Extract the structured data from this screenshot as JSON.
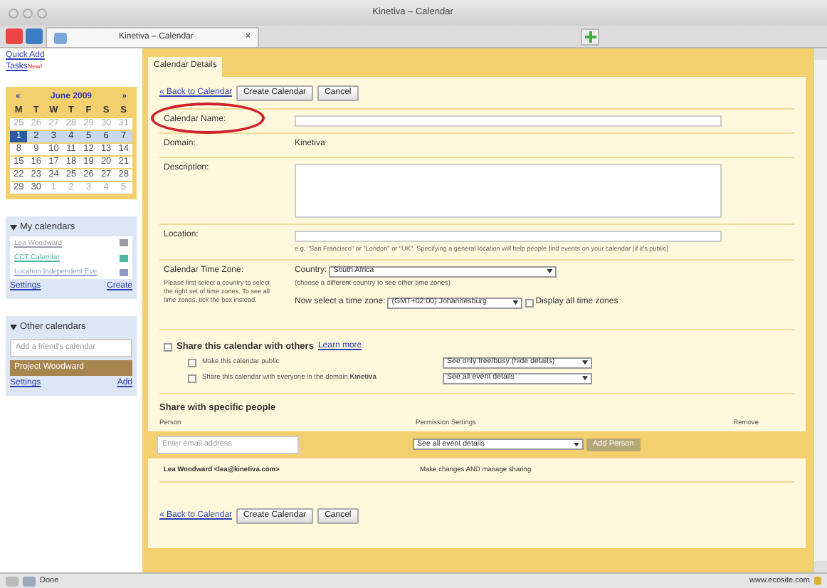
{
  "window": {
    "title": "Kinetiva – Calendar",
    "tab_title": "Kinetiva – Calendar",
    "tab_close": "×"
  },
  "sidebar": {
    "quick_add": "Quick Add",
    "tasks": "Tasks",
    "tasks_badge": "New!",
    "mini_calendar": {
      "prev": "«",
      "month": "June 2009",
      "next": "»",
      "weekdays": [
        "M",
        "T",
        "W",
        "T",
        "F",
        "S",
        "S"
      ],
      "weeks": [
        {
          "selected": false,
          "days": [
            {
              "day": "25",
              "other_month": true,
              "today": false
            },
            {
              "day": "26",
              "other_month": true,
              "today": false
            },
            {
              "day": "27",
              "other_month": true,
              "today": false
            },
            {
              "day": "28",
              "other_month": true,
              "today": false
            },
            {
              "day": "29",
              "other_month": true,
              "today": false
            },
            {
              "day": "30",
              "other_month": true,
              "today": false
            },
            {
              "day": "31",
              "other_month": true,
              "today": false
            }
          ]
        },
        {
          "selected": true,
          "days": [
            {
              "day": "1",
              "other_month": false,
              "today": true
            },
            {
              "day": "2",
              "other_month": false,
              "today": false
            },
            {
              "day": "3",
              "other_month": false,
              "today": false
            },
            {
              "day": "4",
              "other_month": false,
              "today": false
            },
            {
              "day": "5",
              "other_month": false,
              "today": false
            },
            {
              "day": "6",
              "other_month": false,
              "today": false
            },
            {
              "day": "7",
              "other_month": false,
              "today": false
            }
          ]
        },
        {
          "selected": false,
          "days": [
            {
              "day": "8",
              "other_month": false,
              "today": false
            },
            {
              "day": "9",
              "other_month": false,
              "today": false
            },
            {
              "day": "10",
              "other_month": false,
              "today": false
            },
            {
              "day": "11",
              "other_month": false,
              "today": false
            },
            {
              "day": "12",
              "other_month": false,
              "today": false
            },
            {
              "day": "13",
              "other_month": false,
              "today": false
            },
            {
              "day": "14",
              "other_month": false,
              "today": false
            }
          ]
        },
        {
          "selected": false,
          "days": [
            {
              "day": "15",
              "other_month": false,
              "today": false
            },
            {
              "day": "16",
              "other_month": false,
              "today": false
            },
            {
              "day": "17",
              "other_month": false,
              "today": false
            },
            {
              "day": "18",
              "other_month": false,
              "today": false
            },
            {
              "day": "19",
              "other_month": false,
              "today": false
            },
            {
              "day": "20",
              "other_month": false,
              "today": false
            },
            {
              "day": "21",
              "other_month": false,
              "today": false
            }
          ]
        },
        {
          "selected": false,
          "days": [
            {
              "day": "22",
              "other_month": false,
              "today": false
            },
            {
              "day": "23",
              "other_month": false,
              "today": false
            },
            {
              "day": "24",
              "other_month": false,
              "today": false
            },
            {
              "day": "25",
              "other_month": false,
              "today": false
            },
            {
              "day": "26",
              "other_month": false,
              "today": false
            },
            {
              "day": "27",
              "other_month": false,
              "today": false
            },
            {
              "day": "28",
              "other_month": false,
              "today": false
            }
          ]
        },
        {
          "selected": false,
          "days": [
            {
              "day": "29",
              "other_month": false,
              "today": false
            },
            {
              "day": "30",
              "other_month": false,
              "today": false
            },
            {
              "day": "1",
              "other_month": true,
              "today": false
            },
            {
              "day": "2",
              "other_month": true,
              "today": false
            },
            {
              "day": "3",
              "other_month": true,
              "today": false
            },
            {
              "day": "4",
              "other_month": true,
              "today": false
            },
            {
              "day": "5",
              "other_month": true,
              "today": false
            }
          ]
        }
      ]
    },
    "my_calendars": {
      "title": "My calendars",
      "items": [
        {
          "name": "Lea Woodward",
          "color": "#9a9aa6"
        },
        {
          "name": "CCT Calendar",
          "color": "#4cb6a0"
        },
        {
          "name": "Location Independent Eve",
          "color": "#8a9cc4"
        }
      ],
      "settings": "Settings",
      "create": "Create"
    },
    "other_calendars": {
      "title": "Other calendars",
      "placeholder": "Add a friend's calendar",
      "items": [
        {
          "name": "Project Woodward",
          "color": "#a8844e"
        }
      ],
      "settings": "Settings",
      "add": "Add"
    }
  },
  "main": {
    "tab": "Calendar Details",
    "back": "« Back to Calendar",
    "create": "Create Calendar",
    "cancel": "Cancel",
    "name_label": "Calendar Name:",
    "domain_label": "Domain:",
    "domain": "Kinetiva",
    "description_label": "Description:",
    "location_label": "Location:",
    "location_hint": "e.g. \"San Francisco\" or \"London\" or \"UK\". Specifying a general location will help people find events on your calendar (if it's public)",
    "timezone_label": "Calendar Time Zone:",
    "timezone_help": "Please first select a country to select the right set of time zones. To see all time zones, tick the box instead.",
    "country_label": "Country:",
    "country": "South Africa",
    "country_hint": "(choose a different country to see other time zones)",
    "tz_label": "Now select a time zone:",
    "tz": "(GMT+02:00) Johannesburg",
    "display_all": "Display all time zones",
    "display_all_checked": false,
    "share_checked": false,
    "share_title": "Share this calendar with others",
    "learn_more": "Learn more",
    "share_options": [
      {
        "label": "Make this calendar public",
        "checked": false,
        "select": "See only free/busy (hide details)"
      },
      {
        "label": "Share this calendar with everyone in the domain **Kinetiva**",
        "checked": false,
        "select": "See all event details"
      }
    ],
    "people_title": "Share with specific people",
    "columns": [
      "Person",
      "Permission Settings",
      "Remove"
    ],
    "email_placeholder": "Enter email address",
    "permission": "See all event details",
    "add_person": "Add Person",
    "people": [
      {
        "person": "Lea Woodward <lea@kinetiva.com>",
        "permission": "Make changes AND manage sharing"
      }
    ],
    "back_bottom": "« Back to Calendar",
    "create_bottom": "Create Calendar",
    "cancel_bottom": "Cancel"
  },
  "status_bar": {
    "text": "Done",
    "url": "www.ecosite.com"
  }
}
